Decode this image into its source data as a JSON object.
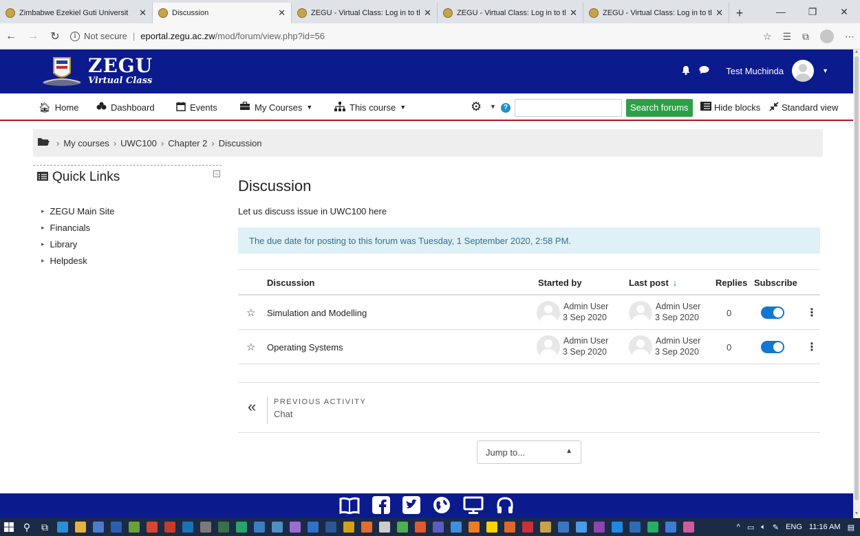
{
  "browser": {
    "tabs": [
      {
        "title": "Zimbabwe Ezekiel Guti Universit",
        "active": false
      },
      {
        "title": "Discussion",
        "active": true
      },
      {
        "title": "ZEGU - Virtual Class: Log in to th",
        "active": false
      },
      {
        "title": "ZEGU - Virtual Class: Log in to th",
        "active": false
      },
      {
        "title": "ZEGU - Virtual Class: Log in to th",
        "active": false
      }
    ],
    "security_label": "Not secure",
    "url_host": "eportal.zegu.ac.zw",
    "url_path": "/mod/forum/view.php?id=56"
  },
  "header": {
    "logo_title": "ZEGU",
    "logo_subtitle": "Virtual Class",
    "user_name": "Test Muchinda"
  },
  "nav": {
    "home": "Home",
    "dashboard": "Dashboard",
    "events": "Events",
    "my_courses": "My Courses",
    "this_course": "This course",
    "search_button": "Search forums",
    "hide_blocks": "Hide blocks",
    "standard_view": "Standard view"
  },
  "breadcrumb": [
    "My courses",
    "UWC100",
    "Chapter 2",
    "Discussion"
  ],
  "quick_links": {
    "title": "Quick Links",
    "items": [
      "ZEGU Main Site",
      "Financials",
      "Library",
      "Helpdesk"
    ]
  },
  "forum": {
    "title": "Discussion",
    "intro": "Let us discuss issue in UWC100 here",
    "due_notice": "The due date for posting to this forum was Tuesday, 1 September 2020, 2:58 PM.",
    "columns": {
      "discussion": "Discussion",
      "started_by": "Started by",
      "last_post": "Last post",
      "replies": "Replies",
      "subscribe": "Subscribe"
    },
    "rows": [
      {
        "topic": "Simulation and Modelling",
        "started_by": "Admin User",
        "started_date": "3 Sep 2020",
        "last_by": "Admin User",
        "last_date": "3 Sep 2020",
        "replies": "0",
        "subscribed": true
      },
      {
        "topic": "Operating Systems",
        "started_by": "Admin User",
        "started_date": "3 Sep 2020",
        "last_by": "Admin User",
        "last_date": "3 Sep 2020",
        "replies": "0",
        "subscribed": true
      }
    ]
  },
  "activity_nav": {
    "label": "PREVIOUS ACTIVITY",
    "activity": "Chat"
  },
  "jump_to": {
    "selected": "Jump to..."
  },
  "taskbar": {
    "language": "ENG",
    "time": "11:16 AM"
  },
  "colors": {
    "header_bg": "#0b1a8c",
    "nav_underline": "#b3111e",
    "search_button": "#2e9f47",
    "alert_bg": "#dff0f6",
    "toggle_on": "#1177d1"
  }
}
